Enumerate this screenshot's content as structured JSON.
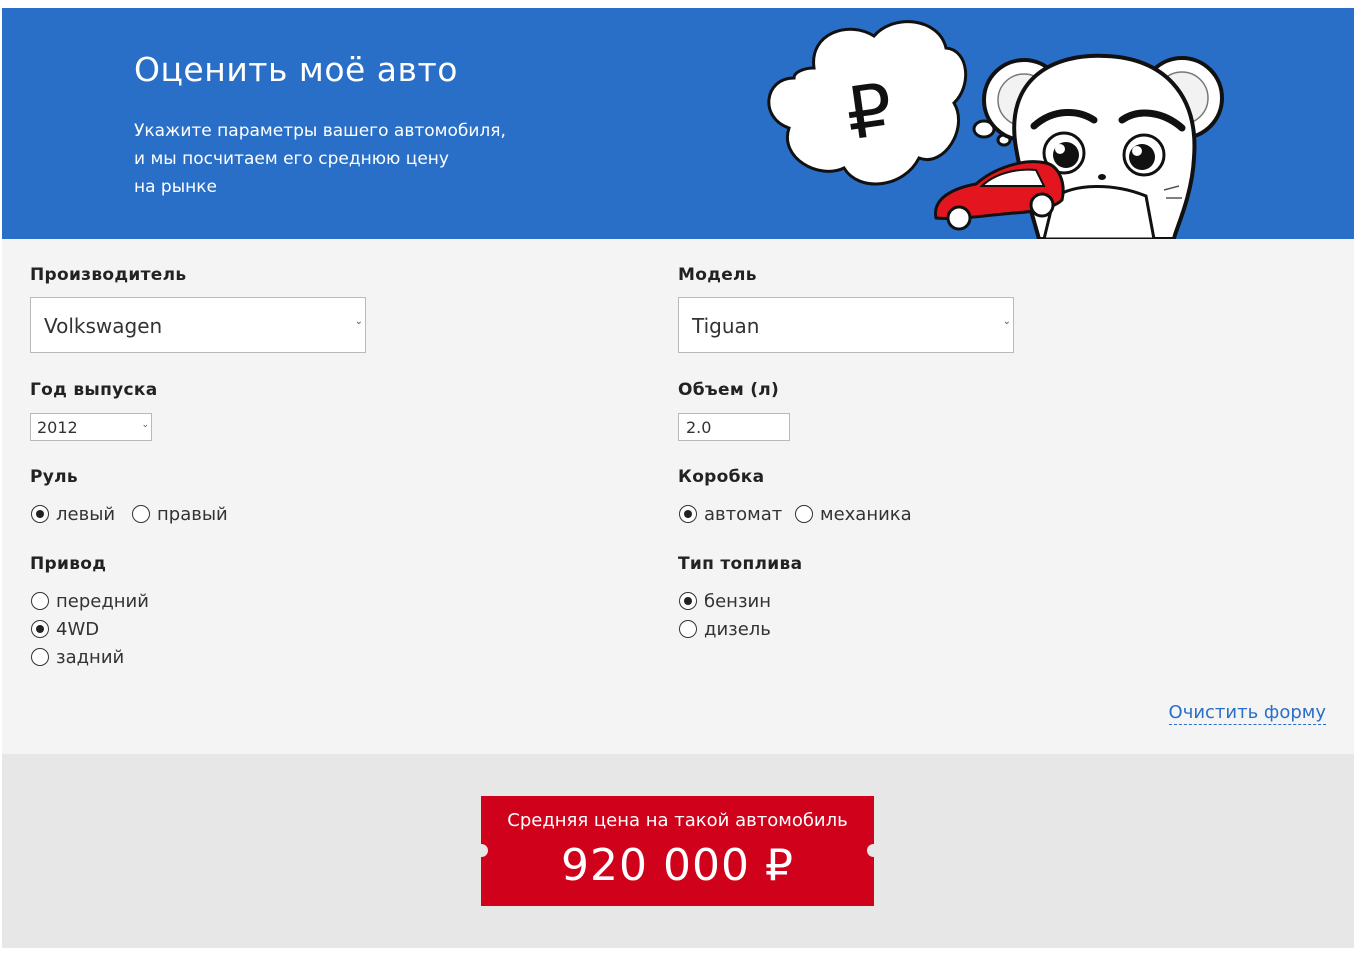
{
  "header": {
    "title": "Оценить моё авто",
    "subtitle_lines": [
      "Укажите параметры вашего автомобиля,",
      "и мы посчитаем его среднюю цену",
      "на рынке"
    ],
    "bubble_symbol": "₽"
  },
  "form": {
    "manufacturer": {
      "label": "Производитель",
      "value": "Volkswagen"
    },
    "model": {
      "label": "Модель",
      "value": "Tiguan"
    },
    "year": {
      "label": "Год выпуска",
      "value": "2012"
    },
    "volume": {
      "label": "Объем (л)",
      "value": "2.0"
    },
    "steering": {
      "label": "Руль",
      "options": [
        {
          "label": "левый",
          "selected": true
        },
        {
          "label": "правый",
          "selected": false
        }
      ]
    },
    "gearbox": {
      "label": "Коробка",
      "options": [
        {
          "label": "автомат",
          "selected": true
        },
        {
          "label": "механика",
          "selected": false
        }
      ]
    },
    "drive": {
      "label": "Привод",
      "options": [
        {
          "label": "передний",
          "selected": false
        },
        {
          "label": "4WD",
          "selected": true
        },
        {
          "label": "задний",
          "selected": false
        }
      ]
    },
    "fuel": {
      "label": "Тип топлива",
      "options": [
        {
          "label": "бензин",
          "selected": true
        },
        {
          "label": "дизель",
          "selected": false
        }
      ]
    },
    "clear_label": "Очистить форму"
  },
  "result": {
    "label": "Средняя цена на такой автомобиль",
    "price": "920 000 ₽"
  },
  "colors": {
    "header_bg": "#2a6fc7",
    "form_bg": "#f4f4f4",
    "result_bg": "#e7e7e7",
    "ticket_bg": "#d0021b",
    "link": "#2a6fc7"
  }
}
